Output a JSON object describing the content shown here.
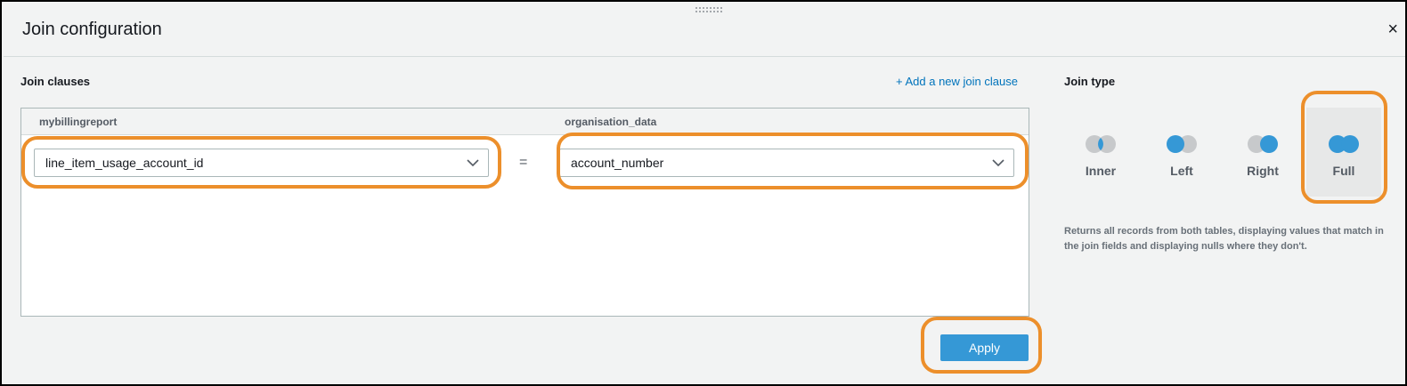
{
  "dialog": {
    "title": "Join configuration",
    "close_symbol": "×"
  },
  "join_clauses": {
    "heading": "Join clauses",
    "add_link": "+ Add a new join clause",
    "left_table": "mybillingreport",
    "right_table": "organisation_data",
    "left_field": "line_item_usage_account_id",
    "operator": "=",
    "right_field": "account_number"
  },
  "join_type": {
    "heading": "Join type",
    "options": [
      {
        "label": "Inner",
        "icon": "inner-join-icon"
      },
      {
        "label": "Left",
        "icon": "left-join-icon"
      },
      {
        "label": "Right",
        "icon": "right-join-icon"
      },
      {
        "label": "Full",
        "icon": "full-join-icon"
      }
    ],
    "selected": "Full",
    "description": "Returns all records from both tables, displaying values that match in the join fields and displaying nulls where they don't."
  },
  "actions": {
    "apply_label": "Apply"
  },
  "colors": {
    "accent": "#3598d6",
    "link": "#0073bb",
    "highlight": "#ec8f2b",
    "venn_gray": "#c7c9cb"
  }
}
